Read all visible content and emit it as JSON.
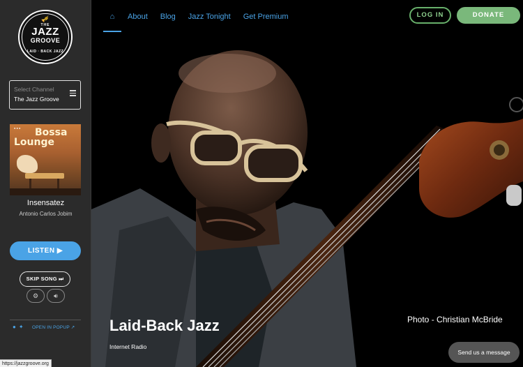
{
  "logo": {
    "the": "THE",
    "line1": "JAZZ",
    "line2": "GROOVE",
    "tagline": "LAID · BACK JAZZ"
  },
  "channel": {
    "label": "Select Channel",
    "value": "The Jazz Groove"
  },
  "album_art": {
    "line1": "Bossa",
    "line2": "Lounge"
  },
  "now_playing": {
    "title": "Insensatez",
    "artist": "Antonio Carlos Jobim"
  },
  "player": {
    "listen_label": "LISTEN ▶",
    "skip_label": "SKIP SONG ⏭",
    "settings_icon": "gear-icon",
    "volume_icon": "volume-icon"
  },
  "social": {
    "facebook_icon": "facebook-icon",
    "twitter_icon": "twitter-icon",
    "popup_label": "OPEN IN POPUP"
  },
  "status_bar": {
    "url": "https://jazzgroove.org"
  },
  "nav": {
    "home_icon": "home-icon",
    "items": [
      "About",
      "Blog",
      "Jazz Tonight",
      "Get Premium"
    ]
  },
  "header": {
    "login_label": "LOG IN",
    "donate_label": "DONATE"
  },
  "hero": {
    "title": "Laid-Back Jazz",
    "subtitle": "Internet Radio",
    "photo_credit": "Photo - Christian McBride"
  },
  "chat": {
    "label": "Send us a message"
  },
  "colors": {
    "accent_blue": "#4aa3e6",
    "donate_green": "#7ab87b",
    "login_green": "#68b06b",
    "sidebar_bg": "#2b2b2b"
  }
}
